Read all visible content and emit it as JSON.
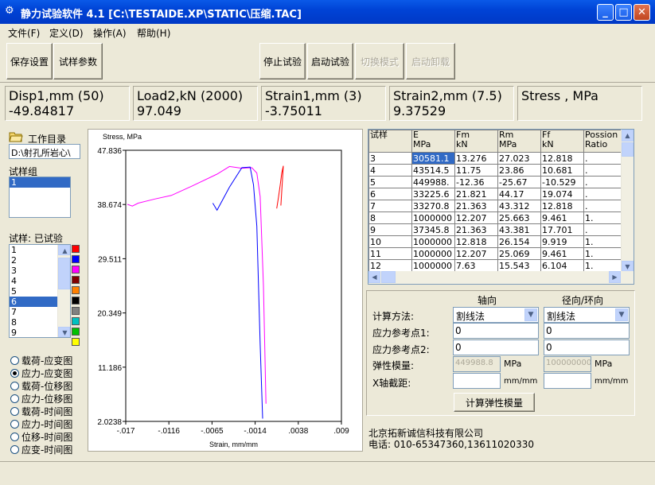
{
  "window": {
    "title": "静力试验软件 4.1 [C:\\TESTAIDE.XP\\STATIC\\压缩.TAC]",
    "icon": "app-icon"
  },
  "menu": [
    "文件(F)",
    "定义(D)",
    "操作(A)",
    "帮助(H)"
  ],
  "toolbar": {
    "save": "保存设置",
    "params": "试样参数",
    "stop": "停止试验",
    "start": "启动试验",
    "switch": "切换模式",
    "unload": "启动卸载"
  },
  "readouts": [
    {
      "label": "Disp1,mm (50)",
      "value": "-49.84817"
    },
    {
      "label": "Load2,kN (2000)",
      "value": "97.049"
    },
    {
      "label": "Strain1,mm (3)",
      "value": "-3.75011"
    },
    {
      "label": "Strain2,mm (7.5)",
      "value": "9.37529"
    },
    {
      "label": "Stress , MPa",
      "value": ""
    }
  ],
  "left": {
    "workdir_label": "工作目录",
    "workdir_value": "D:\\射孔所岩心\\",
    "group_label": "试样组",
    "group_items": [
      "1"
    ],
    "specimen_label": "试样: 已试验",
    "specimen_items": [
      "1",
      "2",
      "3",
      "4",
      "5",
      "6",
      "7",
      "8",
      "9"
    ],
    "selected_specimen": "6",
    "swatches": [
      "#ff0000",
      "#0000ff",
      "#ff00ff",
      "#800000",
      "#ff8000",
      "#000000",
      "#808080",
      "#00c0c0",
      "#00c000",
      "#ffff00"
    ],
    "radios": [
      "载荷-应变图",
      "应力-应变图",
      "载荷-位移图",
      "应力-位移图",
      "载荷-时间图",
      "应力-时间图",
      "位移-时间图",
      "应变-时间图"
    ],
    "radio_selected": 1
  },
  "chart_data": {
    "type": "line",
    "ylabel": "Stress, MPa",
    "xlabel": "Strain, mm/mm",
    "yticks": [
      "47.836",
      "38.674",
      "29.511",
      "20.349",
      "11.186",
      "2.0238"
    ],
    "xticks": [
      "-.017",
      "-.0116",
      "-.0065",
      "-.0014",
      ".0038",
      ".009"
    ],
    "xlim": [
      -0.017,
      0.009
    ],
    "ylim": [
      2.0238,
      47.836
    ],
    "series": [
      {
        "color": "#ff00ff",
        "x": [
          -0.0168,
          -0.0162,
          -0.0155,
          -0.0135,
          -0.0115,
          -0.009,
          -0.006,
          -0.0045,
          -0.003,
          -0.0018,
          -0.0012,
          -0.0008,
          -0.0004,
          -0.0001
        ],
        "y": [
          38.7,
          38.4,
          38.9,
          39.6,
          40.2,
          41.8,
          43.8,
          45.1,
          44.8,
          44.9,
          44.0,
          40.0,
          25.0,
          5.0
        ]
      },
      {
        "color": "#0000ff",
        "x": [
          -0.0065,
          -0.006,
          -0.0055,
          -0.0045,
          -0.003,
          -0.002,
          -0.0016,
          -0.0012,
          -0.0008,
          -0.0005
        ],
        "y": [
          38.9,
          37.7,
          39.0,
          41.6,
          44.9,
          45.0,
          42.0,
          35.0,
          15.0,
          2.5
        ]
      },
      {
        "color": "#ff0000",
        "x": [
          0.0012,
          0.0014,
          0.0016,
          0.0018,
          0.002,
          0.0017
        ],
        "y": [
          38.0,
          39.8,
          41.8,
          44.0,
          45.2,
          38.5
        ]
      }
    ]
  },
  "grid": {
    "headers": [
      [
        "试样",
        ""
      ],
      [
        "E",
        "MPa"
      ],
      [
        "Fm",
        "kN"
      ],
      [
        "Rm",
        "MPa"
      ],
      [
        "Ff",
        "kN"
      ],
      [
        "Possion",
        "Ratio"
      ]
    ],
    "rows": [
      [
        "3",
        "30581.1",
        "13.276",
        "27.023",
        "12.818",
        "."
      ],
      [
        "4",
        "43514.5",
        "11.75",
        "23.86",
        "10.681",
        "."
      ],
      [
        "5",
        "449988.",
        "-12.36",
        "-25.67",
        "-10.529",
        "."
      ],
      [
        "6",
        "33225.6",
        "21.821",
        "44.17",
        "19.074",
        "."
      ],
      [
        "7",
        "33270.8",
        "21.363",
        "43.312",
        "12.818",
        "."
      ],
      [
        "8",
        "1000000",
        "12.207",
        "25.663",
        "9.461",
        "1."
      ],
      [
        "9",
        "37345.8",
        "21.363",
        "43.381",
        "17.701",
        "."
      ],
      [
        "10",
        "1000000",
        "12.818",
        "26.154",
        "9.919",
        "1."
      ],
      [
        "11",
        "1000000",
        "12.207",
        "25.069",
        "9.461",
        "1."
      ],
      [
        "12",
        "1000000",
        "7.63",
        "15.543",
        "6.104",
        "1."
      ]
    ]
  },
  "form": {
    "col_axial": "轴向",
    "col_radial": "径向/环向",
    "method_label": "计算方法:",
    "method_axial": "割线法",
    "method_radial": "割线法",
    "ref1_label": "应力参考点1:",
    "ref1_axial": "0",
    "ref1_radial": "0",
    "ref2_label": "应力参考点2:",
    "ref2_axial": "0",
    "ref2_radial": "0",
    "modulus_label": "弹性模量:",
    "modulus_axial": "449988.8",
    "modulus_radial": "100000000",
    "modulus_unit": "MPa",
    "intercept_label": "X轴截距:",
    "intercept_axial": "",
    "intercept_radial": "",
    "intercept_unit": "mm/mm",
    "calc_button": "计算弹性模量"
  },
  "company": {
    "name": "北京拓新诚信科技有限公司",
    "phone": "电话: 010-65347360,13611020330"
  }
}
